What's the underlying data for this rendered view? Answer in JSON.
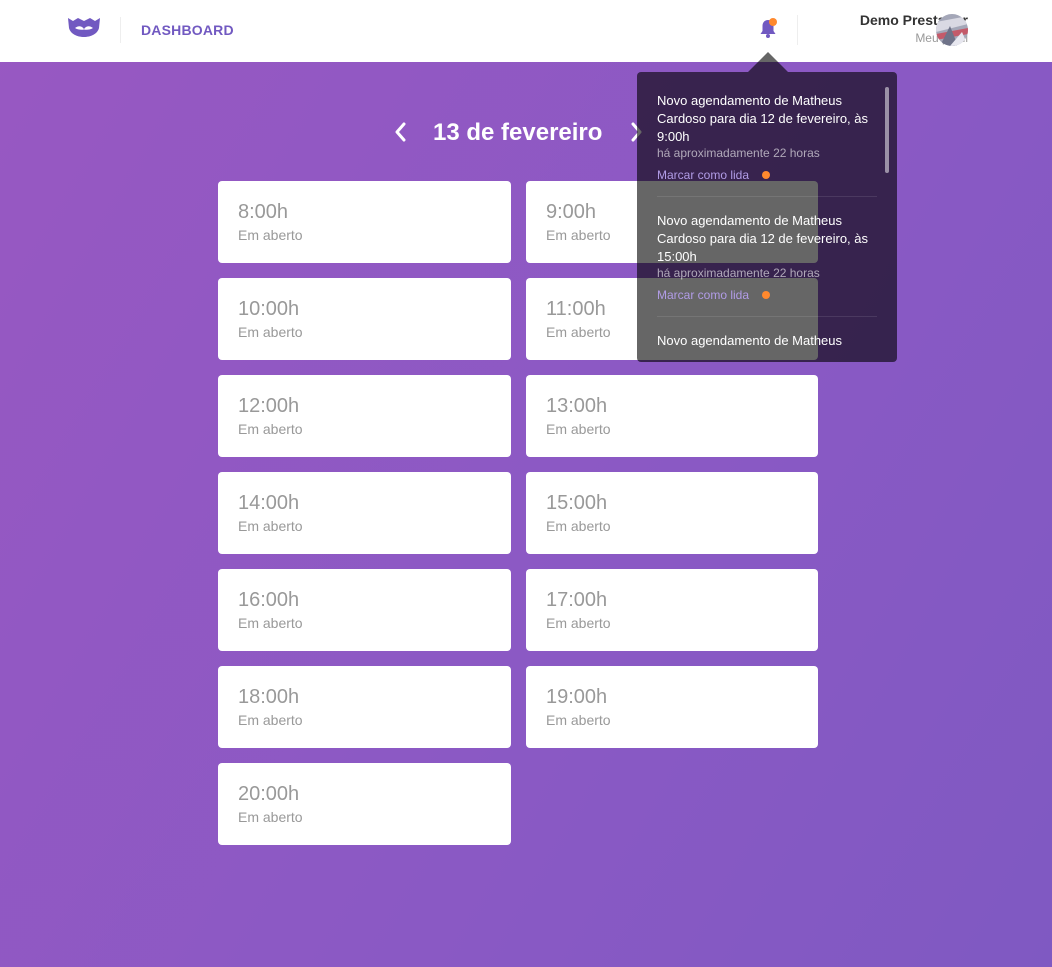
{
  "header": {
    "nav_label": "DASHBOARD",
    "notifications_unread": true,
    "profile": {
      "name": "Demo Prestador",
      "link": "Meu perfil"
    }
  },
  "icons": {
    "logo": "mustache-logo-icon",
    "bell": "bell-icon",
    "prev": "chevron-left-icon",
    "next": "chevron-right-icon"
  },
  "colors": {
    "brand": "#7159c1",
    "background_start": "#9858c2",
    "background_end": "#7f59c2",
    "unread_dot": "#ff892e",
    "action_link": "#b19ce6"
  },
  "schedule": {
    "date_title": "13 de fevereiro",
    "slots": [
      {
        "time": "8:00h",
        "status": "Em aberto"
      },
      {
        "time": "9:00h",
        "status": "Em aberto"
      },
      {
        "time": "10:00h",
        "status": "Em aberto"
      },
      {
        "time": "11:00h",
        "status": "Em aberto"
      },
      {
        "time": "12:00h",
        "status": "Em aberto"
      },
      {
        "time": "13:00h",
        "status": "Em aberto"
      },
      {
        "time": "14:00h",
        "status": "Em aberto"
      },
      {
        "time": "15:00h",
        "status": "Em aberto"
      },
      {
        "time": "16:00h",
        "status": "Em aberto"
      },
      {
        "time": "17:00h",
        "status": "Em aberto"
      },
      {
        "time": "18:00h",
        "status": "Em aberto"
      },
      {
        "time": "19:00h",
        "status": "Em aberto"
      },
      {
        "time": "20:00h",
        "status": "Em aberto"
      }
    ]
  },
  "notifications": {
    "items": [
      {
        "text": "Novo agendamento de Matheus Cardoso para dia 12 de fevereiro, às 9:00h",
        "time": "há aproximadamente 22 horas",
        "action": "Marcar como lida",
        "unread": true
      },
      {
        "text": "Novo agendamento de Matheus Cardoso para dia 12 de fevereiro, às 15:00h",
        "time": "há aproximadamente 22 horas",
        "action": "Marcar como lida",
        "unread": true
      },
      {
        "text": "Novo agendamento de Matheus"
      }
    ]
  }
}
